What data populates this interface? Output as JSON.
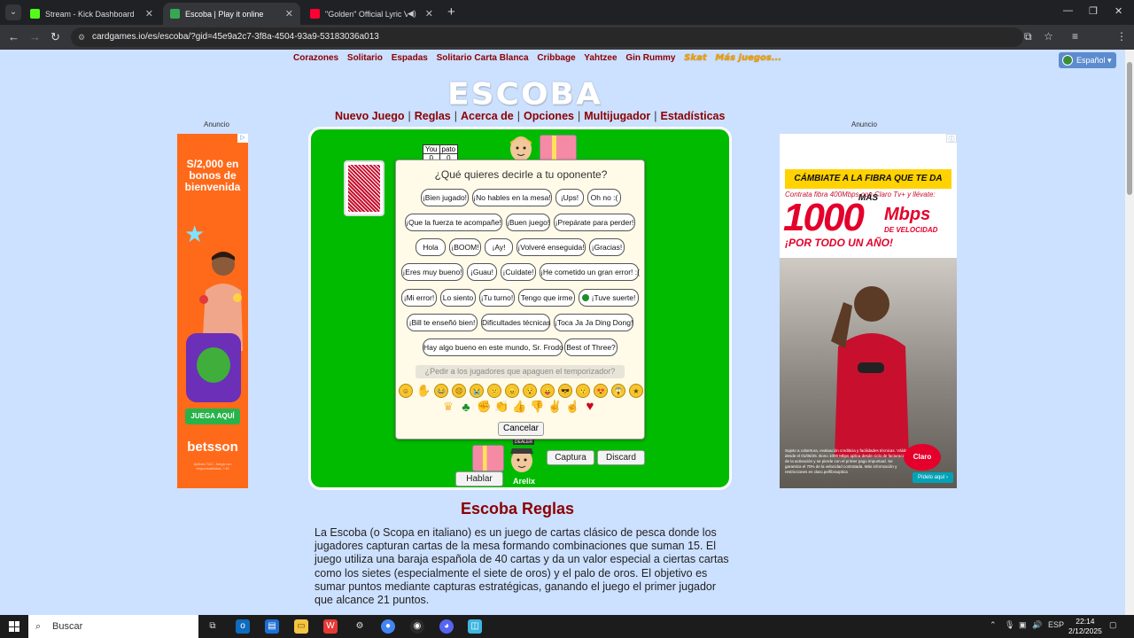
{
  "browser": {
    "tabs": [
      {
        "title": "Stream - Kick Dashboard",
        "favicon_color": "#53fc18",
        "active": false
      },
      {
        "title": "Escoba | Play it online",
        "favicon_color": "#34a853",
        "active": true
      },
      {
        "title": "\"Golden\" Official Lyric Vide",
        "favicon_color": "#ff0033",
        "active": false
      }
    ],
    "url": "cardgames.io/es/escoba/?gid=45e9a2c7-3f8a-4504-93a9-53183036a013"
  },
  "site": {
    "top_links": [
      "Corazones",
      "Solitario",
      "Espadas",
      "Solitario Carta Blanca",
      "Cribbage",
      "Yahtzee",
      "Gin Rummy"
    ],
    "special_links": [
      "Skat",
      "Más juegos..."
    ],
    "language": "Español ▾",
    "logo": "ESCOBA",
    "main_nav": [
      "Nuevo Juego",
      "Reglas",
      "Acerca de",
      "Opciones",
      "Multijugador",
      "Estadísticas"
    ],
    "ad_label": "Anuncio"
  },
  "ad_left": {
    "headline": "S/2,000 en bonos de bienvenida",
    "cta": "JUEGA AQUÍ",
    "brand": "betsson",
    "fine_print": "Aplican T&C. Juega con responsabilidad. +18"
  },
  "ad_right": {
    "banner": "CÁMBIATE A LA FIBRA QUE TE DA MÁS",
    "sub": "Contrata fibra 400Mbps con Claro Tv+ y llévate:",
    "big": "1000",
    "mbps": "Mbps",
    "vel": "DE VELOCIDAD",
    "promo": "¡POR TODO UN AÑO!",
    "legal": "Sujeto a cobertura, evaluación crediticia y facilidades técnicas. Válido desde el 01/06/25. Bono 1000 Mbps aplica desde ciclo de facturación de la activación y se pierde con el primer pago impuntual. Se garantiza el 70% de la velocidad contratada. Más información y restricciones en claro.pe/fibraoptica",
    "brand": "Claro",
    "cta": "Pídelo aquí ›"
  },
  "game": {
    "score": {
      "headers": [
        "You",
        "pato"
      ],
      "values": [
        "0",
        "0"
      ]
    },
    "dialog_question": "¿Qué quieres decirle a tu oponente?",
    "phrases": [
      "¡Bien jugado!",
      "¡No hables en la mesa!",
      "¡Ups!",
      "Oh no :(",
      "¡Que la fuerza te acompañe!",
      "¡Buen juego!",
      "¡Prepárate para perder!",
      "Hola",
      "¡BOOM!",
      "¡Ay!",
      "¡Volveré enseguida!",
      "¡Gracias!",
      "¡Eres muy bueno!",
      "¡Guau!",
      "¡Cuídate!",
      "¡He cometido un gran error! :(",
      "¡Mi error!",
      "Lo siento",
      "¡Tu turno!",
      "Tengo que irme",
      "¡Tuve suerte!",
      "¡Bill te enseñó bien!",
      "Dificultades técnicas",
      "¡Toca Ja Ja Ding Dong!",
      "Hay algo bueno en este mundo, Sr. Frodo",
      "Best of Three?"
    ],
    "timer_request": "¿Pedir a los jugadores que apaguen el temporizador?",
    "emojis_row1": [
      "☺",
      "✋",
      "😂",
      "☹",
      "😭",
      "😕",
      "😠",
      "😯",
      "😛",
      "😎",
      "😗",
      "😍",
      "😱"
    ],
    "emojis_row2": [
      "♛",
      "♣",
      "✊",
      "👏",
      "👍",
      "👎",
      "✌",
      "☝",
      "♥"
    ],
    "cancel_label": "Cancelar",
    "capture_label": "Captura",
    "discard_label": "Discard",
    "talk_label": "Hablar",
    "dealer_tag": "DEALER",
    "player_name": "Arelix"
  },
  "rules": {
    "title": "Escoba Reglas",
    "text": "La Escoba (o Scopa en italiano) es un juego de cartas clásico de pesca donde los jugadores capturan cartas de la mesa formando combinaciones que suman 15. El juego utiliza una baraja española de 40 cartas y da un valor especial a ciertas cartas como los sietes (especialmente el siete de oros) y el palo de oros. El objetivo es sumar puntos mediante capturas estratégicas, ganando el juego el primer jugador que alcance 21 puntos."
  },
  "taskbar": {
    "search_placeholder": "Buscar",
    "lang": "ESP",
    "time": "22:14",
    "date": "2/12/2025"
  }
}
